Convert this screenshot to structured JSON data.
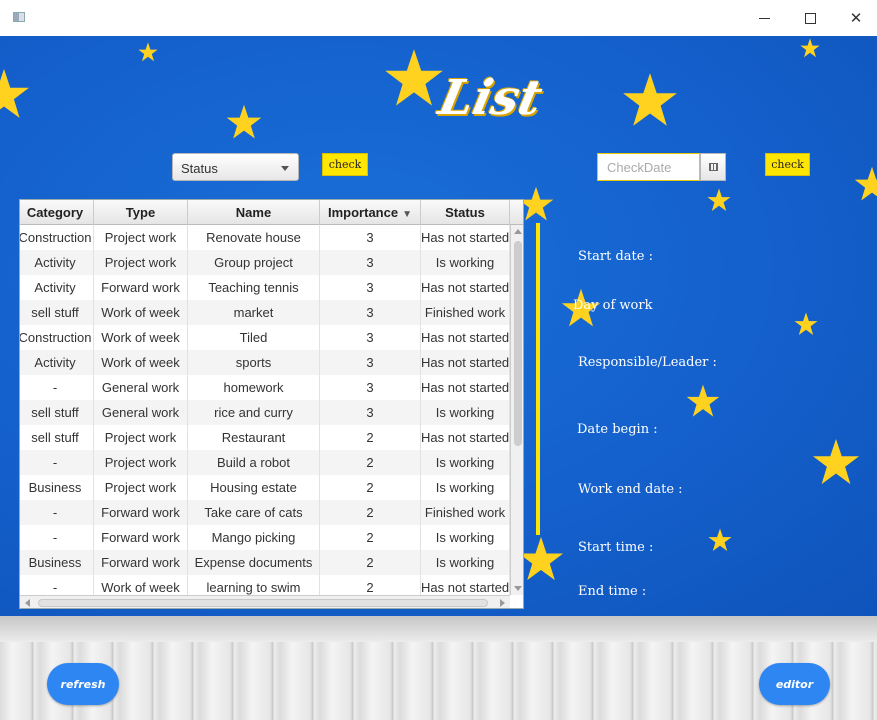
{
  "window": {
    "controls": {
      "minimize": "",
      "maximize": "",
      "close": "✕"
    }
  },
  "header": {
    "title": "List"
  },
  "filters": {
    "status_selected": "Status",
    "check_left_label": "check",
    "date_placeholder": "CheckDate",
    "check_right_label": "check"
  },
  "table": {
    "columns": [
      "Category",
      "Type",
      "Name",
      "Importance",
      "Status"
    ],
    "sort_column": "Importance",
    "rows": [
      [
        "Construction",
        "Project work",
        "Renovate house",
        "3",
        "Has not started"
      ],
      [
        "Activity",
        "Project work",
        "Group project",
        "3",
        "Is working"
      ],
      [
        "Activity",
        "Forward work",
        "Teaching tennis",
        "3",
        "Has not started"
      ],
      [
        "sell stuff",
        "Work of week",
        "market",
        "3",
        "Finished work"
      ],
      [
        "Construction",
        "Work of week",
        "Tiled",
        "3",
        "Has not started"
      ],
      [
        "Activity",
        "Work of week",
        "sports",
        "3",
        "Has not started"
      ],
      [
        "-",
        "General work",
        "homework",
        "3",
        "Has not started"
      ],
      [
        "sell stuff",
        "General work",
        "rice and curry",
        "3",
        "Is working"
      ],
      [
        "sell stuff",
        "Project work",
        "Restaurant",
        "2",
        "Has not started"
      ],
      [
        "-",
        "Project work",
        "Build a robot",
        "2",
        "Is working"
      ],
      [
        "Business",
        "Project work",
        "Housing estate",
        "2",
        "Is working"
      ],
      [
        "-",
        "Forward work",
        "Take care of cats",
        "2",
        "Finished work"
      ],
      [
        "-",
        "Forward work",
        "Mango picking",
        "2",
        "Is working"
      ],
      [
        "Business",
        "Forward work",
        "Expense documents",
        "2",
        "Is working"
      ],
      [
        "-",
        "Work of week",
        "learning to swim",
        "2",
        "Has not started"
      ]
    ]
  },
  "details": {
    "start_date": "Start date :",
    "day_of_work": "Day of work",
    "responsible": "Responsible/Leader  :",
    "date_begin": "Date begin  :",
    "work_end_date": "Work end date :",
    "start_time": "Start time :",
    "end_time": "End time  :"
  },
  "actions": {
    "refresh_label": "refresh",
    "editor_label": "editor"
  },
  "colors": {
    "background_blue": "#1460cc",
    "accent_yellow": "#ffe600",
    "button_blue": "#2e86f2"
  }
}
